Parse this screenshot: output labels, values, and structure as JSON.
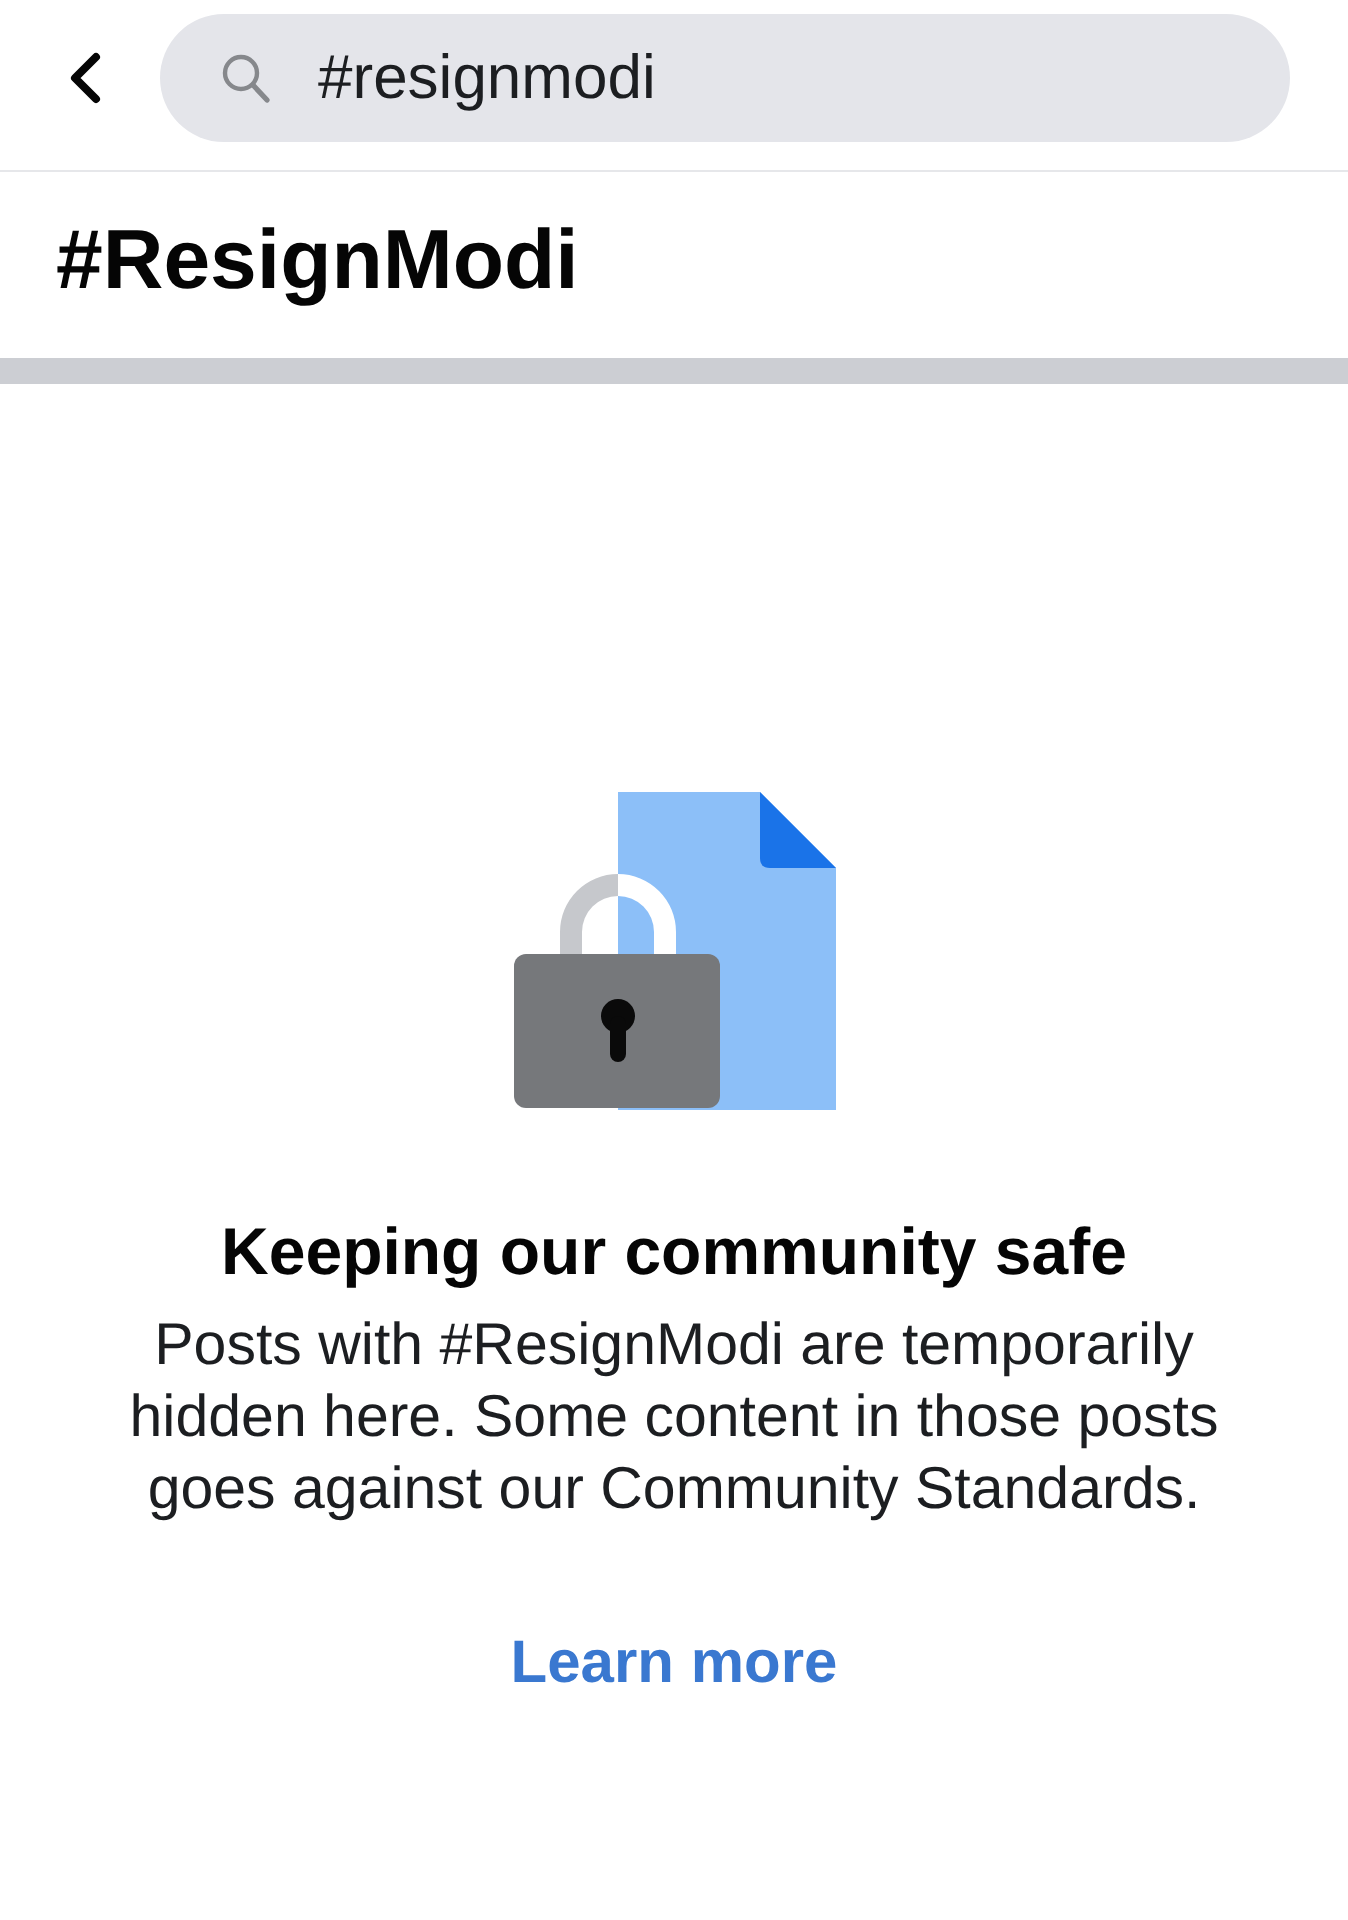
{
  "top_bar": {
    "search": {
      "value": "#resignmodi"
    }
  },
  "header": {
    "title": "#ResignModi"
  },
  "notice": {
    "heading": "Keeping our community safe",
    "body": "Posts with #ResignModi are temporarily hidden here. Some content in those posts goes against our Community Standards.",
    "link": "Learn more"
  }
}
